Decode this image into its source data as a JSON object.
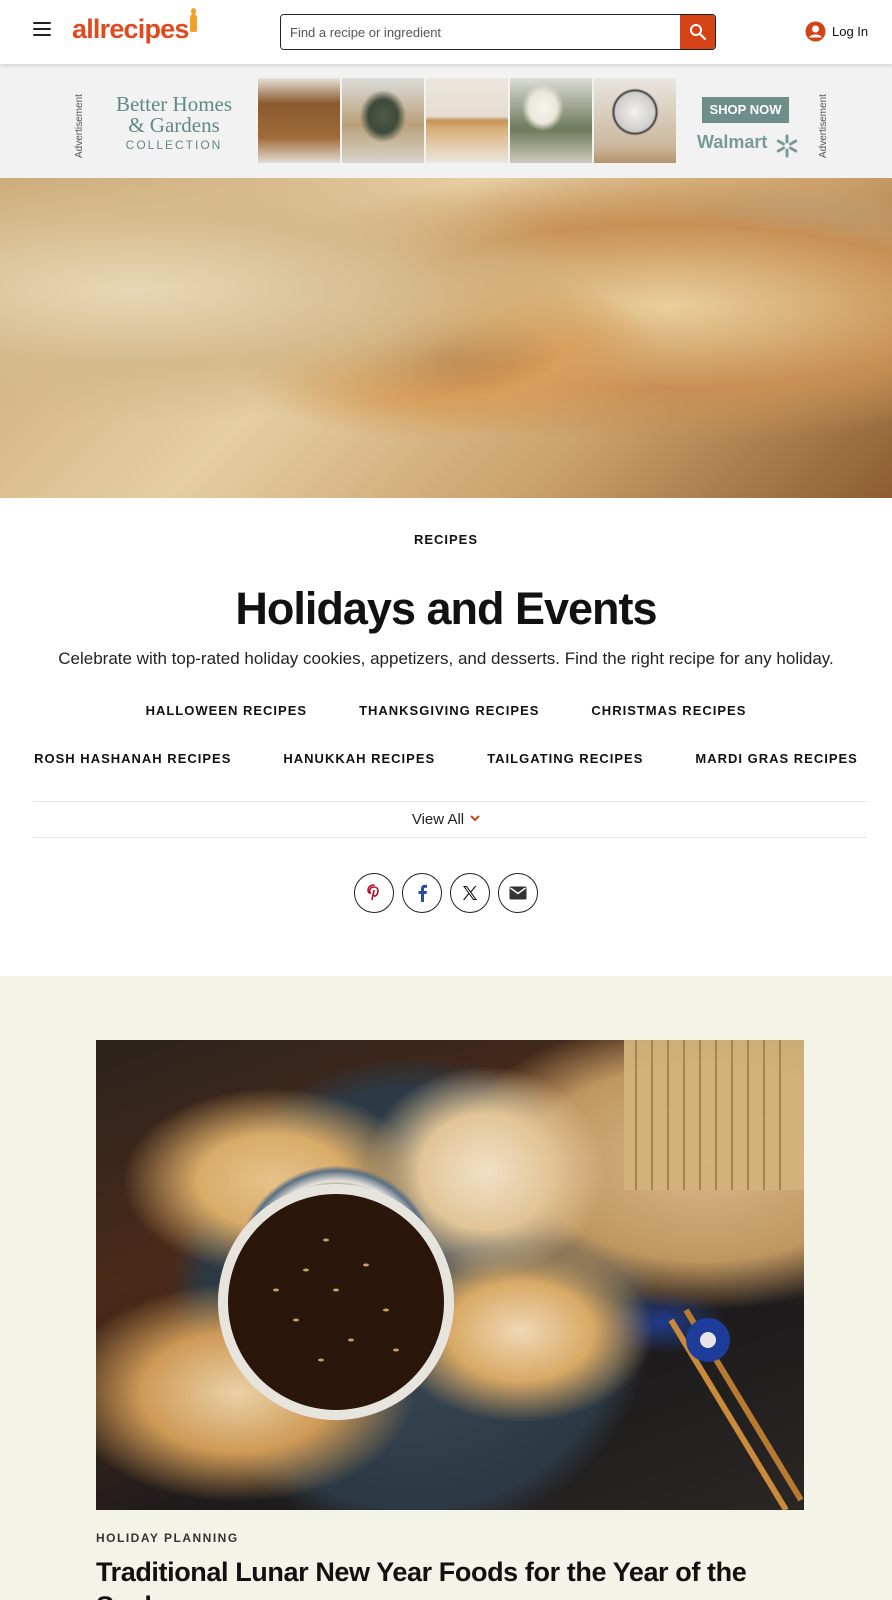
{
  "header": {
    "logo_text": "allrecipes",
    "search_placeholder": "Find a recipe or ingredient",
    "login_label": "Log In"
  },
  "ad": {
    "label": "Advertisement",
    "brand_line1": "Better Homes",
    "brand_line2": "& Gardens",
    "brand_line3": "COLLECTION",
    "cta": "SHOP NOW",
    "retailer": "Walmart"
  },
  "page": {
    "kicker": "RECIPES",
    "title": "Holidays and Events",
    "description": "Celebrate with top-rated holiday cookies, appetizers, and desserts. Find the right recipe for any holiday."
  },
  "taxonomy": {
    "row1": [
      "HALLOWEEN RECIPES",
      "THANKSGIVING RECIPES",
      "CHRISTMAS RECIPES"
    ],
    "row2": [
      "ROSH HASHANAH RECIPES",
      "HANUKKAH RECIPES",
      "TAILGATING RECIPES",
      "MARDI GRAS RECIPES"
    ],
    "view_all": "View All"
  },
  "share": [
    "pinterest-icon",
    "facebook-icon",
    "x-icon",
    "email-icon"
  ],
  "featured": {
    "kicker": "HOLIDAY PLANNING",
    "title": "Traditional Lunar New Year Foods for the Year of the Snake"
  },
  "colors": {
    "brand": "#e04a1f",
    "search_button": "#d54215",
    "lower_bg": "#f3f3e8"
  }
}
